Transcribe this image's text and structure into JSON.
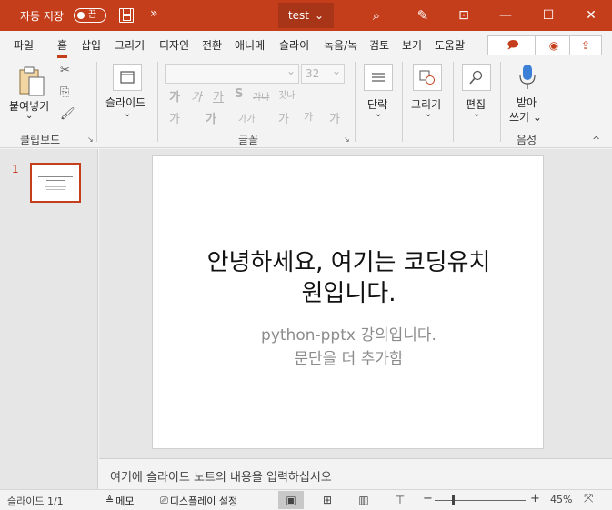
{
  "titlebar": {
    "autosave_label": "자동 저장",
    "autosave_state": "끔",
    "more": "»",
    "doc_title": "test",
    "title_chevron": "⌄",
    "search_icon": "⌕",
    "pen_icon": "✎",
    "ribbon_display_icon": "⊡",
    "minimize": "—",
    "maximize": "☐",
    "close": "✕"
  },
  "tabs": [
    "파일",
    "홈",
    "삽입",
    "그리기",
    "디자인",
    "전환",
    "애니메",
    "슬라이",
    "녹음/녹",
    "검토",
    "보기",
    "도움말"
  ],
  "tab_buttons": {
    "comment_icon": "🗩",
    "record_icon": "◉",
    "share_icon": "⇪"
  },
  "ribbon": {
    "clipboard": {
      "paste_label": "붙여넣기",
      "paste_chevron": "⌄",
      "cut_icon": "✂",
      "copy_icon": "⎘",
      "format_painter_icon": "🖌",
      "group_label": "클립보드",
      "launcher": "↘"
    },
    "slides": {
      "new_slide_label": "슬라이드",
      "chevron": "⌄"
    },
    "font": {
      "size_value": "32",
      "row2": [
        "가",
        "가",
        "가",
        "S",
        "가나",
        "갓나"
      ],
      "row3": [
        "가",
        "가가",
        "가",
        "가"
      ],
      "group_label": "글꼴",
      "launcher": "↘"
    },
    "paragraph": {
      "label": "단락",
      "chevron": "⌄"
    },
    "drawing": {
      "label": "그리기",
      "chevron": "⌄"
    },
    "editing": {
      "label": "편집",
      "chevron": "⌄"
    },
    "voice": {
      "label_line1": "받아",
      "label_line2": "쓰기 ⌄",
      "group_label": "음성"
    },
    "collapse": "^"
  },
  "thumbnails": [
    {
      "number": "1"
    }
  ],
  "slide": {
    "title_line1": "안녕하세요, 여기는 코딩유치",
    "title_line2": "원입니다.",
    "subtitle_line1": "python-pptx 강의입니다.",
    "subtitle_line2": "문단을 더 추가함"
  },
  "notes_placeholder": "여기에 슬라이드 노트의 내용을 입력하십시오",
  "statusbar": {
    "slide_count": "슬라이드 1/1",
    "notes_label": "메모",
    "display_settings_label": "디스플레이 설정",
    "zoom_minus": "−",
    "zoom_plus": "+",
    "zoom_level": "45%",
    "fit_icon": "⤧"
  },
  "colors": {
    "accent": "#c43e1c",
    "title_bar": "#c43e1c"
  }
}
